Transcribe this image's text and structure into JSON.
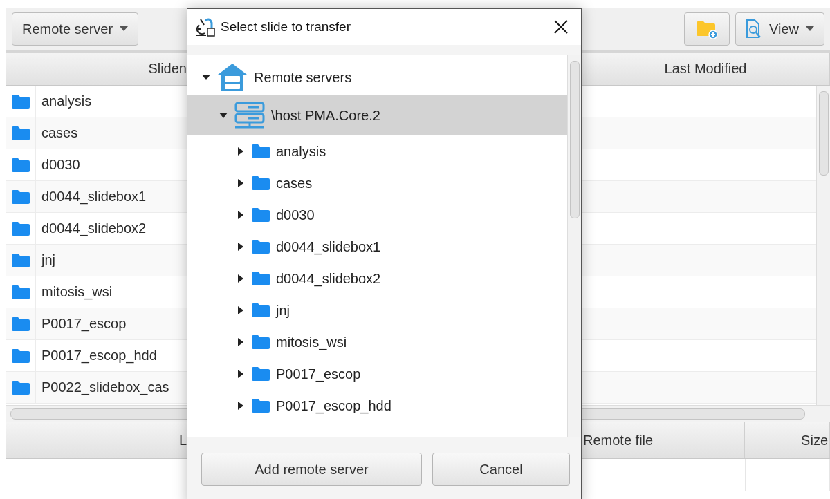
{
  "toolbar": {
    "server_dropdown": "Remote server",
    "view_button": "View"
  },
  "slides_table": {
    "columns": [
      "Sliden",
      "Last Modified"
    ],
    "rows": [
      "analysis",
      "cases",
      "d0030",
      "d0044_slidebox1",
      "d0044_slidebox2",
      "jnj",
      "mitosis_wsi",
      "P0017_escop",
      "P0017_escop_hdd",
      "P0022_slidebox_cas"
    ]
  },
  "transfer_table": {
    "columns": [
      "L",
      "Remote file",
      "Size"
    ]
  },
  "dialog": {
    "title": "Select slide to transfer",
    "tree": [
      {
        "label": "Remote servers",
        "kind": "group",
        "expanded": true,
        "selected": false,
        "children": [
          {
            "label": "\\host PMA.Core.2",
            "kind": "server",
            "expanded": true,
            "selected": true,
            "children": [
              {
                "label": "analysis",
                "kind": "folder",
                "expanded": false,
                "selected": false
              },
              {
                "label": "cases",
                "kind": "folder",
                "expanded": false,
                "selected": false
              },
              {
                "label": "d0030",
                "kind": "folder",
                "expanded": false,
                "selected": false
              },
              {
                "label": "d0044_slidebox1",
                "kind": "folder",
                "expanded": false,
                "selected": false
              },
              {
                "label": "d0044_slidebox2",
                "kind": "folder",
                "expanded": false,
                "selected": false
              },
              {
                "label": "jnj",
                "kind": "folder",
                "expanded": false,
                "selected": false
              },
              {
                "label": "mitosis_wsi",
                "kind": "folder",
                "expanded": false,
                "selected": false
              },
              {
                "label": "P0017_escop",
                "kind": "folder",
                "expanded": false,
                "selected": false
              },
              {
                "label": "P0017_escop_hdd",
                "kind": "folder",
                "expanded": false,
                "selected": false
              }
            ]
          }
        ]
      }
    ],
    "buttons": [
      "Add remote server",
      "Cancel"
    ]
  }
}
